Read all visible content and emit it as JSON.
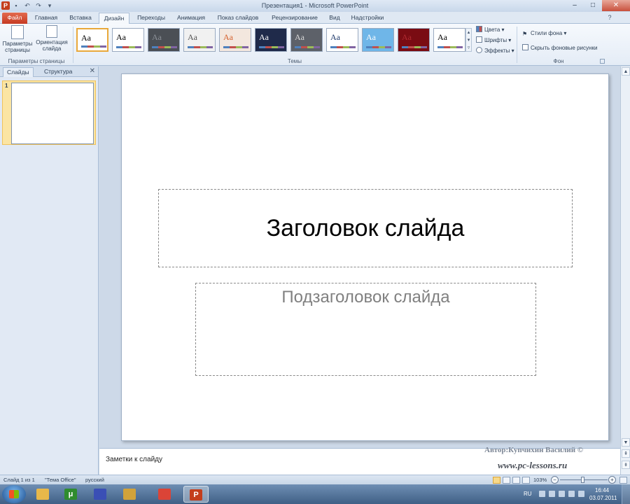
{
  "titlebar": {
    "app_icon_letter": "P",
    "title": "Презентация1 - Microsoft PowerPoint",
    "icons": [
      "save-icon",
      "undo-icon",
      "redo-icon",
      "customize-qat-icon"
    ]
  },
  "ribbon_tabs": [
    "Файл",
    "Главная",
    "Вставка",
    "Дизайн",
    "Переходы",
    "Анимация",
    "Показ слайдов",
    "Рецензирование",
    "Вид",
    "Надстройки"
  ],
  "page_setup": {
    "params_label": "Параметры страницы",
    "orientation_label": "Ориентация слайда",
    "group_label": "Параметры страницы"
  },
  "themes": {
    "group_label": "Темы",
    "sample": "Aa",
    "items": [
      {
        "bg": "#ffffff",
        "fg": "#000000"
      },
      {
        "bg": "#ffffff",
        "fg": "#000000"
      },
      {
        "bg": "#4b4f55",
        "fg": "#8a8f96"
      },
      {
        "bg": "#f1f1f1",
        "fg": "#555555"
      },
      {
        "bg": "#f3e7de",
        "fg": "#d45f2b"
      },
      {
        "bg": "#1f2a4a",
        "fg": "#ffffff"
      },
      {
        "bg": "#5d6169",
        "fg": "#d9d9d9"
      },
      {
        "bg": "#ffffff",
        "fg": "#1f3a6b"
      },
      {
        "bg": "#6fb6e8",
        "fg": "#ffffff"
      },
      {
        "bg": "#7a0c13",
        "fg": "#b02a30"
      },
      {
        "bg": "#ffffff",
        "fg": "#000000"
      }
    ]
  },
  "theme_options": {
    "colors": "Цвета",
    "fonts": "Шрифты",
    "effects": "Эффекты"
  },
  "background": {
    "styles": "Стили фона",
    "hide_graphics": "Скрыть фоновые рисунки",
    "group_label": "Фон"
  },
  "left_pane": {
    "tab_slides": "Слайды",
    "tab_outline": "Структура",
    "slide_number": "1"
  },
  "slide": {
    "title_placeholder": "Заголовок слайда",
    "subtitle_placeholder": "Подзаголовок слайда"
  },
  "notes": {
    "placeholder": "Заметки к слайду"
  },
  "watermark": {
    "author": "Автор:Купчихин Василий ©",
    "site": "www.pc-lessons.ru"
  },
  "statusbar": {
    "slide_info": "Слайд 1 из 1",
    "theme": "\"Тема Office\"",
    "language": "русский",
    "zoom": "103%",
    "zoom_level_percent": 103
  },
  "taskbar": {
    "language": "RU",
    "time": "16:44",
    "date": "03.07.2011",
    "apps": [
      {
        "name": "explorer",
        "glyph": "",
        "color": "#e8b84a"
      },
      {
        "name": "utorrent",
        "glyph": "μ",
        "color": "#2f8c2f"
      },
      {
        "name": "save-app",
        "glyph": "",
        "color": "#3a4fb5"
      },
      {
        "name": "tool-app",
        "glyph": "",
        "color": "#d1a23a"
      },
      {
        "name": "chrome",
        "glyph": "",
        "color": "#db4437"
      },
      {
        "name": "powerpoint",
        "glyph": "P",
        "color": "#c43e1c"
      }
    ]
  }
}
